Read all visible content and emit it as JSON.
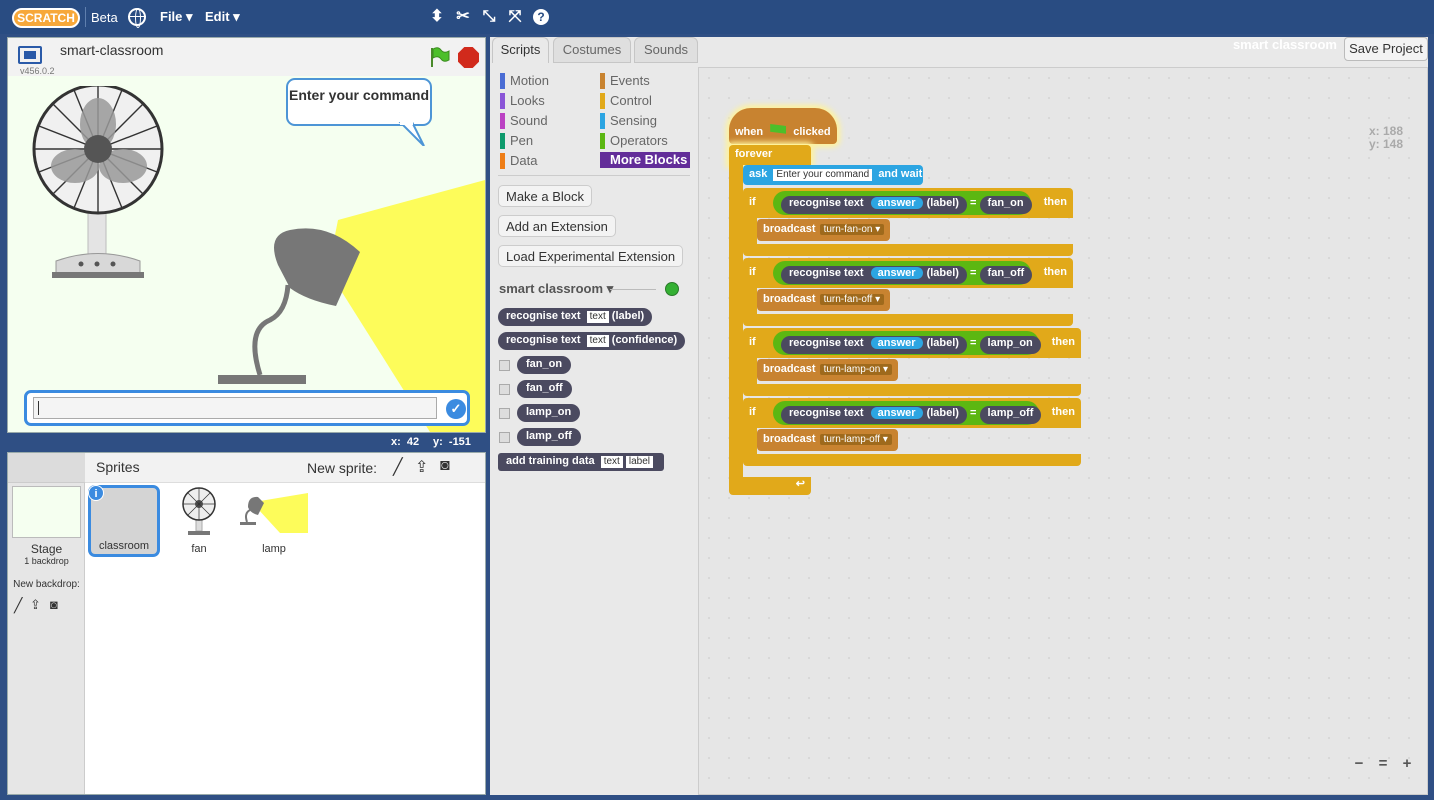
{
  "topbar": {
    "logo_text": "SCRATCH",
    "beta_label": "Beta",
    "file_menu": "File",
    "edit_menu": "Edit"
  },
  "stage": {
    "project_name": "smart-classroom",
    "version": "v456.0.2",
    "speech_bubble": "Enter your command",
    "mouse_x_label": "x:",
    "mouse_x": "42",
    "mouse_y_label": "y:",
    "mouse_y": "-151"
  },
  "sprites": {
    "title": "Sprites",
    "new_sprite_label": "New sprite:",
    "stage_label": "Stage",
    "backdrop_count": "1 backdrop",
    "new_backdrop_label": "New backdrop:",
    "items": [
      {
        "name": "classroom"
      },
      {
        "name": "fan"
      },
      {
        "name": "lamp"
      }
    ]
  },
  "palette": {
    "tabs": [
      "Scripts",
      "Costumes",
      "Sounds"
    ],
    "categories_left": [
      "Motion",
      "Looks",
      "Sound",
      "Pen",
      "Data"
    ],
    "categories_right": [
      "Events",
      "Control",
      "Sensing",
      "Operators",
      "More Blocks"
    ],
    "colors": {
      "Motion": "#4a6cd4",
      "Looks": "#8a55d7",
      "Sound": "#bb42c3",
      "Pen": "#0e9a6c",
      "Data": "#ee7d16",
      "Events": "#c88330",
      "Control": "#e1a91a",
      "Sensing": "#2ca5e2",
      "Operators": "#5cb712"
    },
    "buttons": [
      "Make a Block",
      "Add an Extension",
      "Load Experimental Extension"
    ],
    "extension_name": "smart classroom",
    "blocks": {
      "recognise_label": [
        "recognise",
        "text",
        "text",
        "(label)"
      ],
      "recognise_conf": [
        "recognise",
        "text",
        "text",
        "(confidence)"
      ],
      "add_training": [
        "add",
        "training",
        "data",
        "text",
        "label"
      ]
    },
    "reporters": [
      "fan_on",
      "fan_off",
      "lamp_on",
      "lamp_off"
    ]
  },
  "script": {
    "project_title": "smart classroom",
    "save_button": "Save Project",
    "canvas_x": "x: 188",
    "canvas_y": "y: 148",
    "hat": {
      "when": "when",
      "clicked": "clicked"
    },
    "forever": "forever",
    "ask": {
      "ask": "ask",
      "prompt": "Enter your command",
      "and_wait": "and wait"
    },
    "if_label": "if",
    "then_label": "then",
    "recognise": "recognise",
    "text": "text",
    "answer": "answer",
    "label": "(label)",
    "equals": "=",
    "broadcast": "broadcast",
    "ifs": [
      {
        "class": "fan_on",
        "message": "turn-fan-on"
      },
      {
        "class": "fan_off",
        "message": "turn-fan-off"
      },
      {
        "class": "lamp_on",
        "message": "turn-lamp-on"
      },
      {
        "class": "lamp_off",
        "message": "turn-lamp-off"
      }
    ],
    "loop_arrow": "↩"
  },
  "zoom": {
    "out": "−",
    "reset": "=",
    "in": "+"
  }
}
